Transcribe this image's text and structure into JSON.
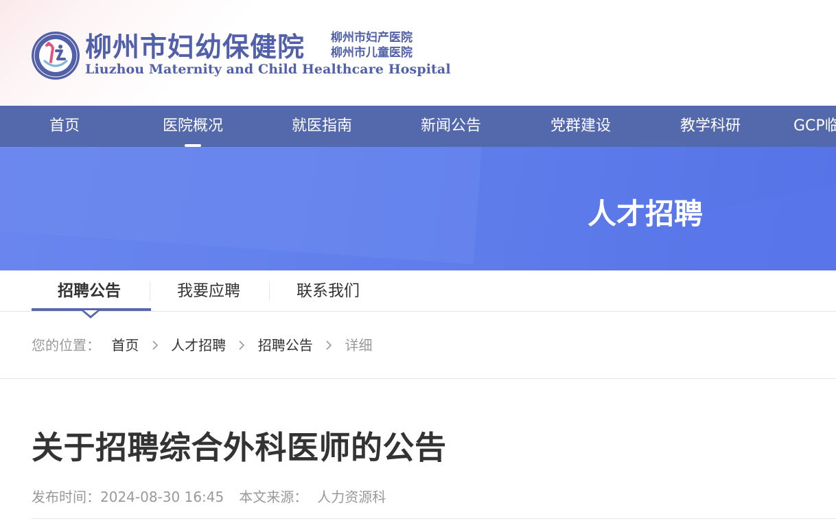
{
  "header": {
    "logo_cn": "柳州市妇幼保健院",
    "logo_sub_1": "柳州市妇产医院",
    "logo_sub_2": "柳州市儿童医院",
    "logo_en": "Liuzhou Maternity and Child Healthcare Hospital",
    "logo_icon": "hospital-emblem-icon"
  },
  "nav": {
    "items": [
      {
        "label": "首页"
      },
      {
        "label": "医院概况",
        "active": true
      },
      {
        "label": "就医指南"
      },
      {
        "label": "新闻公告"
      },
      {
        "label": "党群建设"
      },
      {
        "label": "教学科研"
      },
      {
        "label": "GCP临"
      }
    ]
  },
  "banner": {
    "title": "人才招聘"
  },
  "subtabs": {
    "items": [
      {
        "label": "招聘公告",
        "active": true
      },
      {
        "label": "我要应聘"
      },
      {
        "label": "联系我们"
      }
    ]
  },
  "breadcrumb": {
    "label": "您的位置：",
    "items": [
      "首页",
      "人才招聘",
      "招聘公告",
      "详细"
    ],
    "separator_icon": "chevron-right-icon"
  },
  "article": {
    "title": "关于招聘综合外科医师的公告",
    "date_label": "发布时间：",
    "date": "2024-08-30 16:45",
    "source_label": "本文来源：",
    "source": "人力资源科"
  },
  "colors": {
    "brand": "#5468ac",
    "banner": "#6080ec",
    "logo_text": "#5160a8"
  }
}
